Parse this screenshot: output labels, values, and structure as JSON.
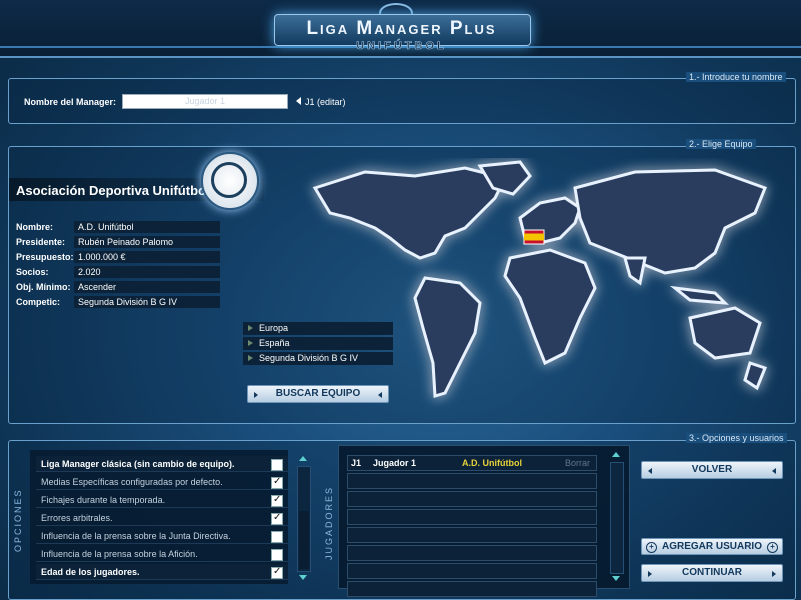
{
  "app": {
    "title": "Liga Manager Plus",
    "subtitle": "UNIFÚTBOL"
  },
  "sections": {
    "step1": "1.- Introduce tu nombre",
    "step2": "2.- Elige Equipo",
    "step3": "3.- Opciones y usuarios"
  },
  "manager": {
    "label": "Nombre del Manager:",
    "placeholder": "Jugador 1",
    "edit_hint": "J1 (editar)"
  },
  "club": {
    "name": "Asociación Deportiva Unifútbol",
    "fields": [
      {
        "label": "Nombre:",
        "value": "A.D. Unifútbol"
      },
      {
        "label": "Presidente:",
        "value": "Rubén Peinado Palomo"
      },
      {
        "label": "Presupuesto:",
        "value": "1.000.000 €"
      },
      {
        "label": "Socios:",
        "value": "2.020"
      },
      {
        "label": "Obj. Mínimo:",
        "value": "Ascender"
      },
      {
        "label": "Competic:",
        "value": "Segunda División B G IV"
      }
    ]
  },
  "location": [
    "Europa",
    "España",
    "Segunda División B G IV"
  ],
  "buttons": {
    "search_team": "BUSCAR EQUIPO",
    "back": "VOLVER",
    "add_user": "AGREGAR USUARIO",
    "continue": "CONTINUAR"
  },
  "options": {
    "label": "OPCIONES",
    "items": [
      {
        "text": "Liga Manager clásica (sin cambio de equipo).",
        "checked": false,
        "active": true
      },
      {
        "text": "Medias Específicas configuradas por defecto.",
        "checked": true,
        "active": false
      },
      {
        "text": "Fichajes durante la temporada.",
        "checked": true,
        "active": false
      },
      {
        "text": "Errores arbitrales.",
        "checked": true,
        "active": false
      },
      {
        "text": "Influencia de la prensa sobre la Junta Directiva.",
        "checked": false,
        "active": false
      },
      {
        "text": "Influencia de la prensa sobre la Afición.",
        "checked": false,
        "active": false
      },
      {
        "text": "Edad de los jugadores.",
        "checked": true,
        "active": true
      }
    ]
  },
  "players": {
    "label": "JUGADORES",
    "rows": [
      {
        "id": "J1",
        "name": "Jugador 1",
        "team": "A.D. Unifútbol",
        "action": "Borrar"
      }
    ],
    "empty_rows": 7
  },
  "colors": {
    "team_highlight": "#e8d23a",
    "accent": "#5b94c4",
    "background": "#1a4e7c"
  },
  "icons": {
    "club_badge": "unifutbol-logo-icon",
    "spain_flag": "spain-flag-icon"
  }
}
